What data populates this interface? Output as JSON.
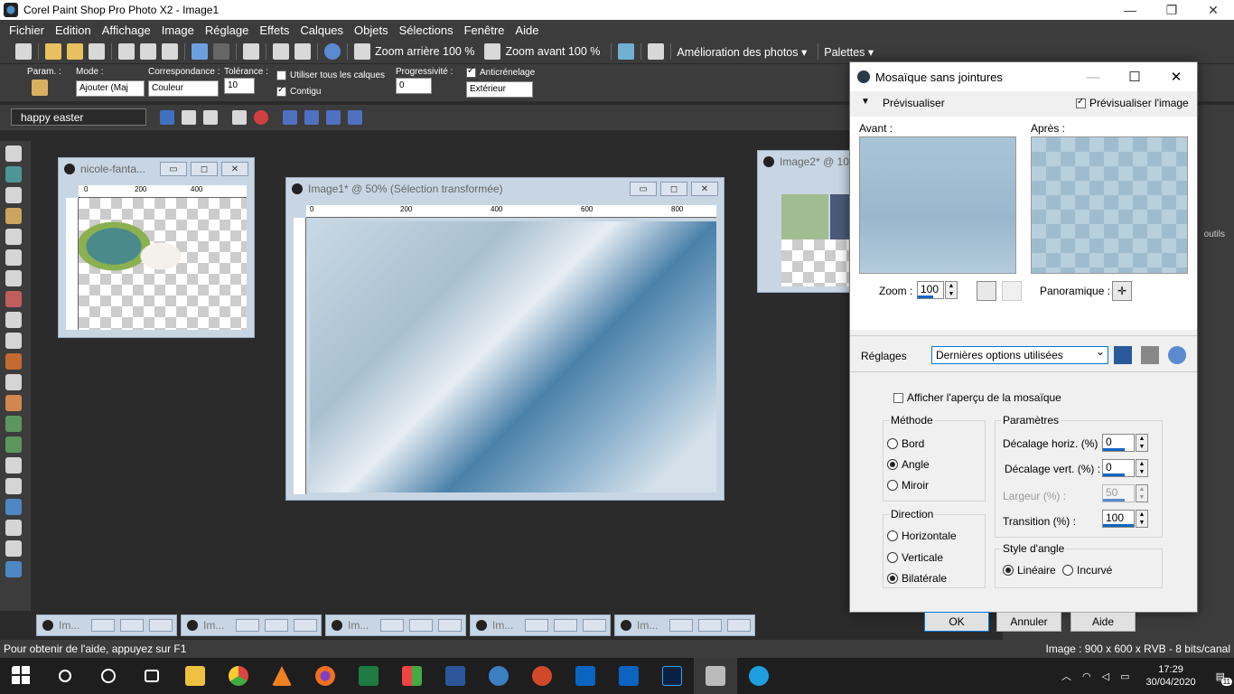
{
  "window": {
    "title": "Corel Paint Shop Pro Photo X2 - Image1"
  },
  "menu": [
    "Fichier",
    "Edition",
    "Affichage",
    "Image",
    "Réglage",
    "Effets",
    "Calques",
    "Objets",
    "Sélections",
    "Fenêtre",
    "Aide"
  ],
  "toolbar": {
    "zoom_out": "Zoom arrière 100 %",
    "zoom_in": "Zoom avant 100 %",
    "enhance": "Amélioration des photos",
    "palettes": "Palettes"
  },
  "tool_options": {
    "param_label": "Param. :",
    "mode_label": "Mode :",
    "mode_value": "Ajouter (Maj",
    "match_label": "Correspondance :",
    "match_value": "Couleur",
    "tolerance_label": "Tolérance :",
    "tolerance_value": "10",
    "use_all_layers": "Utiliser tous les calques",
    "contiguous": "Contigu",
    "feather_label": "Progressivité :",
    "feather_value": "0",
    "antialias": "Anticrénelage",
    "antialias_value": "Extérieur"
  },
  "script_bar": {
    "preset": "happy easter"
  },
  "documents": {
    "doc1_title": "nicole-fanta...",
    "doc2_title": "Image1* @  50% (Sélection transformée)",
    "doc3_title": "Image2* @ 10",
    "ruler1": [
      "0",
      "200",
      "400"
    ],
    "ruler2": [
      "0",
      "200",
      "400",
      "600",
      "800"
    ]
  },
  "minimized": [
    "Im...",
    "Im...",
    "Im...",
    "Im...",
    "Im..."
  ],
  "dialog": {
    "title": "Mosaïque sans jointures",
    "preview_toggle": "Prévisualiser",
    "preview_image": "Prévisualiser l'image",
    "before": "Avant :",
    "after": "Après :",
    "zoom_label": "Zoom :",
    "zoom_value": "100",
    "pan_label": "Panoramique :",
    "settings_label": "Réglages",
    "settings_value": "Dernières options utilisées",
    "show_tile_preview": "Afficher l'aperçu de la mosaïque",
    "method_group": "Méthode",
    "method_options": [
      "Bord",
      "Angle",
      "Miroir"
    ],
    "method_selected": "Angle",
    "direction_group": "Direction",
    "direction_options": [
      "Horizontale",
      "Verticale",
      "Bilatérale"
    ],
    "direction_selected": "Bilatérale",
    "params_group": "Paramètres",
    "h_offset_label": "Décalage horiz. (%) :",
    "h_offset_value": "0",
    "v_offset_label": "Décalage vert. (%) :",
    "v_offset_value": "0",
    "width_label": "Largeur (%) :",
    "width_value": "50",
    "transition_label": "Transition (%) :",
    "transition_value": "100",
    "corner_group": "Style d'angle",
    "corner_options": [
      "Linéaire",
      "Incurvé"
    ],
    "corner_selected": "Linéaire",
    "ok": "OK",
    "cancel": "Annuler",
    "help": "Aide"
  },
  "status": {
    "help": "Pour obtenir de l'aide, appuyez sur F1",
    "image_info": "Image :  900 x 600 x RVB - 8 bits/canal"
  },
  "right_panel": {
    "tools_label": "outils"
  },
  "taskbar": {
    "time": "17:29",
    "date": "30/04/2020",
    "notifications": "11"
  },
  "colors": {
    "accent": "#0078d7",
    "chrome": "#3c3c3c",
    "doc_frame": "#c8d6e4"
  }
}
